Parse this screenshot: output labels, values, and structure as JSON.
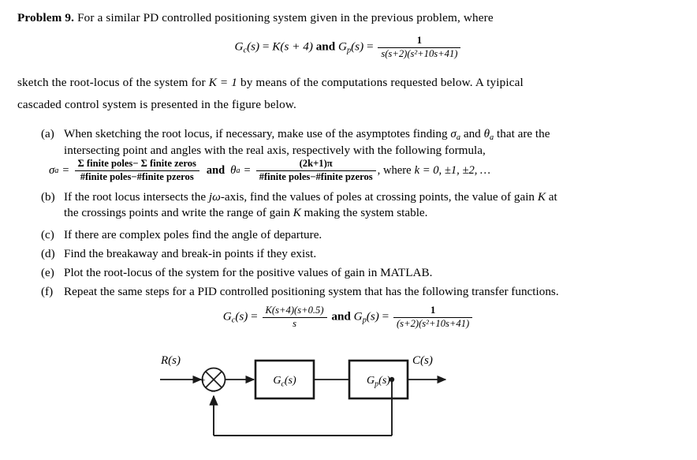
{
  "document": {
    "problem_label": "Problem 9.",
    "intro_line_1": "For a similar PD controlled positioning system given in the previous problem, where",
    "body_line_1": "sketch the root-locus of the system for",
    "body_line_1_math": "K = 1",
    "body_line_1_cont": "by means of the computations requested below. A tyipical",
    "body_line_2": "cascaded control system is presented in the figure below."
  },
  "equation_1": {
    "gc_name": "G",
    "gc_sub": "c",
    "gc_arg": "(s)",
    "equals": "=",
    "gc_expr": "K(s + 4)",
    "conj": "and",
    "gp_name": "G",
    "gp_sub": "p",
    "gp_arg": "(s)",
    "gp_numerator": "1",
    "gp_denominator": "s(s+2)(s²+10s+41)"
  },
  "equation_2": {
    "gc_name": "G",
    "gc_sub": "c",
    "gc_arg": "(s)",
    "equals": "=",
    "gc_numerator": "K(s+4)(s+0.5)",
    "gc_denominator": "s",
    "conj": "and",
    "gp_name": "G",
    "gp_sub": "p",
    "gp_arg": "(s)",
    "gp_numerator": "1",
    "gp_denominator": "(s+2)(s²+10s+41)"
  },
  "items": {
    "a": {
      "marker": "(a)",
      "line1_pre": "When sketching the root locus, if necessary, make use of the asymptotes finding",
      "line1_sym1": "σ",
      "line1_sym1_sub": "a",
      "line1_mid": "and",
      "line1_sym2": "θ",
      "line1_sym2_sub": "a",
      "line1_post": "that are the",
      "line2": "intersecting point and angles with the real axis, respectively with the following formula,",
      "formula": {
        "sigma_sym": "σ",
        "sigma_sub": "a",
        "equals": "=",
        "sigma_num": "Σ finite poles− Σ finite zeros",
        "sigma_den": "#finite poles−#finite pzeros",
        "conj": "and",
        "theta_sym": "θ",
        "theta_sub": "a",
        "theta_num": "(2k+1)π",
        "theta_den": "#finite poles−#finite pzeros",
        "where_pre": ", where",
        "where_k": "k = 0, ±1, ±2, …"
      }
    },
    "b": {
      "marker": "(b)",
      "line1_pre": "If the root locus intersects the",
      "line1_math": "jω",
      "line1_mid": "-axis, find the values of poles at crossing points, the value of gain",
      "line1_k": "K",
      "line1_post": "at",
      "line2_pre": "the crossings points and write the range of gain",
      "line2_k": "K",
      "line2_post": "making the system stable."
    },
    "c": {
      "marker": "(c)",
      "text": "If there are complex poles find the angle of departure."
    },
    "d": {
      "marker": "(d)",
      "text": "Find the breakaway and break-in points if they exist."
    },
    "e": {
      "marker": "(e)",
      "text": "Plot the root-locus of the system for the positive values of gain in MATLAB."
    },
    "f": {
      "marker": "(f)",
      "text": "Repeat the same steps for a PID controlled positioning system that has the following transfer functions."
    }
  },
  "block_diagram": {
    "input_label": "R(s)",
    "output_label": "C(s)",
    "block1_label": "G",
    "block1_sub": "c",
    "block1_arg": "(s)",
    "block2_label": "G",
    "block2_sub": "p",
    "block2_arg": "(s)",
    "sum_plus": "+",
    "sum_minus": "−",
    "line_color": "#1a1a1a",
    "block_fill": "#ffffff"
  }
}
